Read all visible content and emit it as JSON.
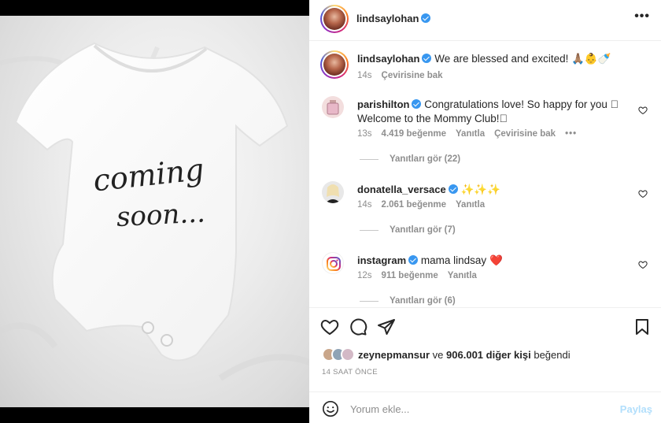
{
  "post": {
    "image_text_line1": "coming",
    "image_text_line2": "soon..."
  },
  "header": {
    "username": "lindsaylohan",
    "more_icon": "more-horizontal-icon"
  },
  "caption": {
    "username": "lindsaylohan",
    "text": "We are blessed and excited! 🙏🏽👶🍼",
    "time": "14s",
    "translate": "Çevirisine bak"
  },
  "comments": [
    {
      "username": "parishilton",
      "text": "Congratulations love! So happy for you 🏽 Welcome to the Mommy Club!🏽",
      "time": "13s",
      "likes": "4.419 beğenme",
      "reply": "Yanıtla",
      "translate": "Çevirisine bak",
      "view_replies": "Yanıtları gör (22)"
    },
    {
      "username": "donatella_versace",
      "text": "✨✨✨",
      "time": "14s",
      "likes": "2.061 beğenme",
      "reply": "Yanıtla",
      "view_replies": "Yanıtları gör (7)"
    },
    {
      "username": "instagram",
      "text": "mama lindsay ❤️",
      "time": "12s",
      "likes": "911 beğenme",
      "reply": "Yanıtla",
      "view_replies": "Yanıtları gör (6)"
    }
  ],
  "likes": {
    "user": "zeynepmansur",
    "connector": "ve",
    "count_text": "906.001 diğer kişi",
    "suffix": "beğendi"
  },
  "timestamp": "14 SAAT ÖNCE",
  "comment_box": {
    "placeholder": "Yorum ekle...",
    "post_label": "Paylaş"
  },
  "colors": {
    "verified": "#3897f0",
    "post_button_disabled": "#b2dffc",
    "heart_red": "#ed4956"
  }
}
